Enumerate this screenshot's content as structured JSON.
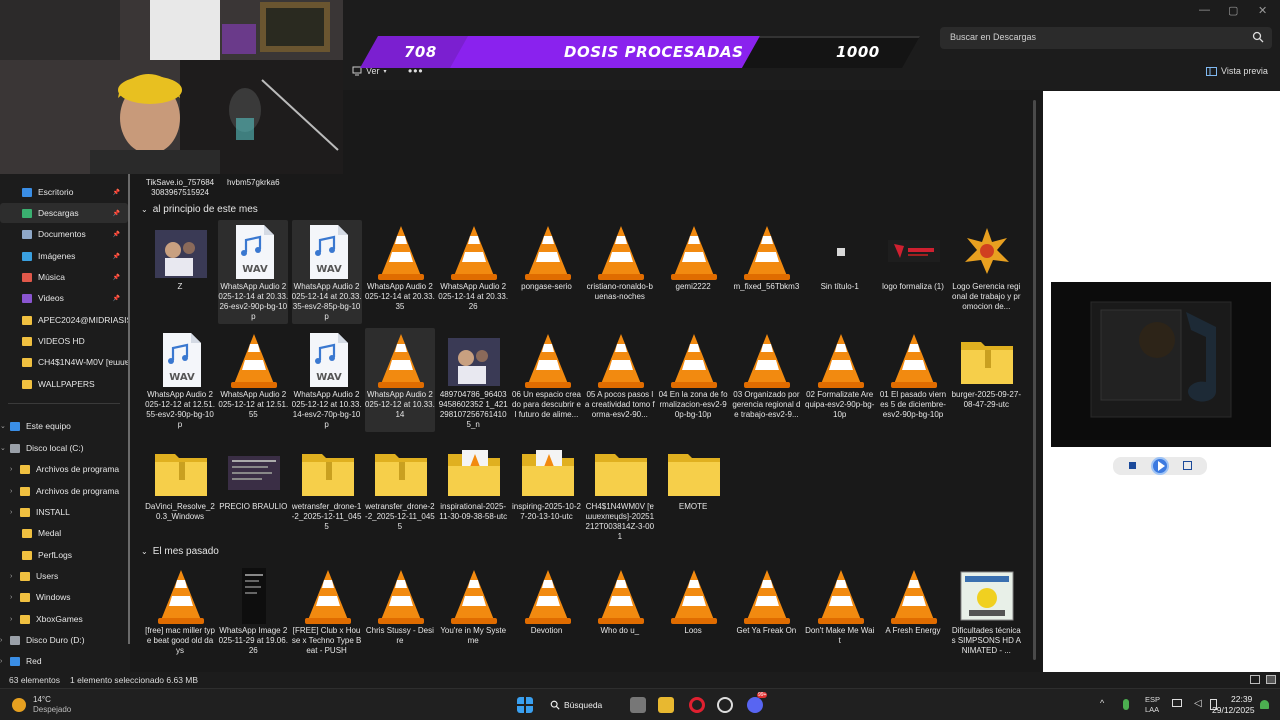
{
  "window": {
    "minimize": "—",
    "maximize": "▢",
    "close": "✕"
  },
  "stream_banner": {
    "count": "708",
    "label": "DOSIS PROCESADAS",
    "goal": "1000",
    "progress": 0.708
  },
  "toolbar": {
    "view_label": "Ver",
    "more_label": "•••",
    "preview_label": "Vista previa"
  },
  "search": {
    "placeholder": "Buscar en Descargas"
  },
  "sidebar": {
    "items": [
      {
        "label": "Escritorio",
        "pinned": true,
        "color": "#3a8ee6"
      },
      {
        "label": "Descargas",
        "pinned": true,
        "color": "#3ab070"
      },
      {
        "label": "Documentos",
        "pinned": true,
        "color": "#8fa8c8"
      },
      {
        "label": "Imágenes",
        "pinned": true,
        "color": "#3aa0e0"
      },
      {
        "label": "Música",
        "pinned": true,
        "color": "#e0584a"
      },
      {
        "label": "Videos",
        "pinned": true,
        "color": "#8a55d0"
      },
      {
        "label": "APEC2024@MIDRIASIS",
        "color": "#f0c040"
      },
      {
        "label": "VIDEOS HD",
        "color": "#f0c040"
      },
      {
        "label": "CH4$1N4W-M0V [ɐɯuɐ",
        "color": "#f0c040"
      },
      {
        "label": "WALLPAPERS",
        "color": "#f0c040"
      },
      {
        "label": "Este equipo",
        "color": "#3a8ee6"
      },
      {
        "label": "Disco local (C:)",
        "color": "#9aa0a8"
      },
      {
        "label": "Archivos de programa",
        "color": "#f0c040"
      },
      {
        "label": "Archivos de programa",
        "color": "#f0c040"
      },
      {
        "label": "INSTALL",
        "color": "#f0c040"
      },
      {
        "label": "Medal",
        "color": "#f0c040"
      },
      {
        "label": "PerfLogs",
        "color": "#f0c040"
      },
      {
        "label": "Users",
        "color": "#f0c040"
      },
      {
        "label": "Windows",
        "color": "#f0c040"
      },
      {
        "label": "XboxGames",
        "color": "#f0c040"
      },
      {
        "label": "Disco Duro (D:)",
        "color": "#9aa0a8"
      },
      {
        "label": "Red",
        "color": "#3a8ee6"
      }
    ]
  },
  "files": {
    "top_partial": [
      {
        "label": "TikSave.io_7576843083967515924"
      },
      {
        "label": "hvbm57gkrka6"
      }
    ],
    "sections": [
      {
        "title": "al principio de este mes"
      },
      {
        "title": "El mes pasado"
      }
    ],
    "this_month": [
      {
        "label": "Z",
        "type": "photo"
      },
      {
        "label": "WhatsApp Audio 2025-12-14 at 20.33.26-esv2-90p-bg-10p",
        "type": "wav"
      },
      {
        "label": "WhatsApp Audio 2025-12-14 at 20.33.35-esv2-85p-bg-10p",
        "type": "wav"
      },
      {
        "label": "WhatsApp Audio 2025-12-14 at 20.33.35",
        "type": "vlc"
      },
      {
        "label": "WhatsApp Audio 2025-12-14 at 20.33.26",
        "type": "vlc"
      },
      {
        "label": "pongase-serio",
        "type": "vlc"
      },
      {
        "label": "cristiano-ronaldo-buenas-noches",
        "type": "vlc"
      },
      {
        "label": "gemi2222",
        "type": "vlc"
      },
      {
        "label": "m_fixed_56Tbkm3",
        "type": "vlc"
      },
      {
        "label": "Sin título-1",
        "type": "blank"
      },
      {
        "label": "logo formaliza (1)",
        "type": "logo"
      },
      {
        "label": "Logo Gerencia regional de trabajo y promocion de...",
        "type": "logo2"
      },
      {
        "label": "WhatsApp Audio 2025-12-12 at 12.51.55-esv2-90p-bg-10p",
        "type": "wav"
      },
      {
        "label": "WhatsApp Audio 2025-12-12 at 12.51.55",
        "type": "vlc"
      },
      {
        "label": "WhatsApp Audio 2025-12-12 at 10.33.14-esv2-70p-bg-10p",
        "type": "wav"
      },
      {
        "label": "WhatsApp Audio 2025-12-12 at 10.33.14",
        "type": "vlc"
      },
      {
        "label": "489704786_964039458602352 1_4212981072567614105_n",
        "type": "photo"
      },
      {
        "label": "06 Un espacio creado para descubrir el futuro de alime...",
        "type": "vlc"
      },
      {
        "label": "05 A pocos pasos la creatividad tomo forma-esv2-90...",
        "type": "vlc"
      },
      {
        "label": "04 En la zona de formalizacion-esv2-90p-bg-10p",
        "type": "vlc"
      },
      {
        "label": "03 Organizado por gerencia regional de trabajo-esv2-9...",
        "type": "vlc"
      },
      {
        "label": "02 Formalizate Arequipa-esv2-90p-bg-10p",
        "type": "vlc"
      },
      {
        "label": "01 El pasado viernes 5 de diciembre-esv2-90p-bg-10p",
        "type": "vlc"
      },
      {
        "label": "burger-2025-09-27-08-47-29-utc",
        "type": "zip"
      },
      {
        "label": "DaVinci_Resolve_20.3_Windows",
        "type": "zip"
      },
      {
        "label": "PRECIO BRAULIO",
        "type": "screen"
      },
      {
        "label": "wetransfer_drone-1-2_2025-12-11_0455",
        "type": "zip"
      },
      {
        "label": "wetransfer_drone-2-2_2025-12-11_0455",
        "type": "zip"
      },
      {
        "label": "inspirational-2025-11-30-09-38-58-utc",
        "type": "folder-vlc"
      },
      {
        "label": "inspiring-2025-10-27-20-13-10-utc",
        "type": "folder-vlc"
      },
      {
        "label": "CH4$1N4WM0V [ɐɯuɐxnɐɥds]-20251212T003814Z-3-001",
        "type": "folder"
      },
      {
        "label": "EMOTE",
        "type": "folder"
      }
    ],
    "last_month": [
      {
        "label": "[free] mac miller type beat good old days",
        "type": "vlc"
      },
      {
        "label": "WhatsApp Image 2025-11-29 at 19.06.26",
        "type": "phone"
      },
      {
        "label": "[FREE] Club x House x Techno Type Beat - PUSH",
        "type": "vlc"
      },
      {
        "label": "Chris Stussy - Desire",
        "type": "vlc"
      },
      {
        "label": "You're in My Systeme",
        "type": "vlc"
      },
      {
        "label": "Devotion",
        "type": "vlc"
      },
      {
        "label": "Who do u_",
        "type": "vlc"
      },
      {
        "label": "Loos",
        "type": "vlc"
      },
      {
        "label": "Get Ya Freak On",
        "type": "vlc"
      },
      {
        "label": "Don't Make Me Wait",
        "type": "vlc"
      },
      {
        "label": "A Fresh Energy",
        "type": "vlc"
      },
      {
        "label": "Dificultades técnicas SIMPSONS HD ANIMATED - ...",
        "type": "simpsons"
      }
    ]
  },
  "status": {
    "count": "63 elementos",
    "selection": "1 elemento seleccionado  6.63 MB"
  },
  "taskbar": {
    "weather_temp": "14°C",
    "weather_desc": "Despejado",
    "search_label": "Búsqueda",
    "lang1": "ESP",
    "lang2": "LAA",
    "time": "22:39",
    "date": "29/12/2025",
    "discord_badge": "99+"
  }
}
